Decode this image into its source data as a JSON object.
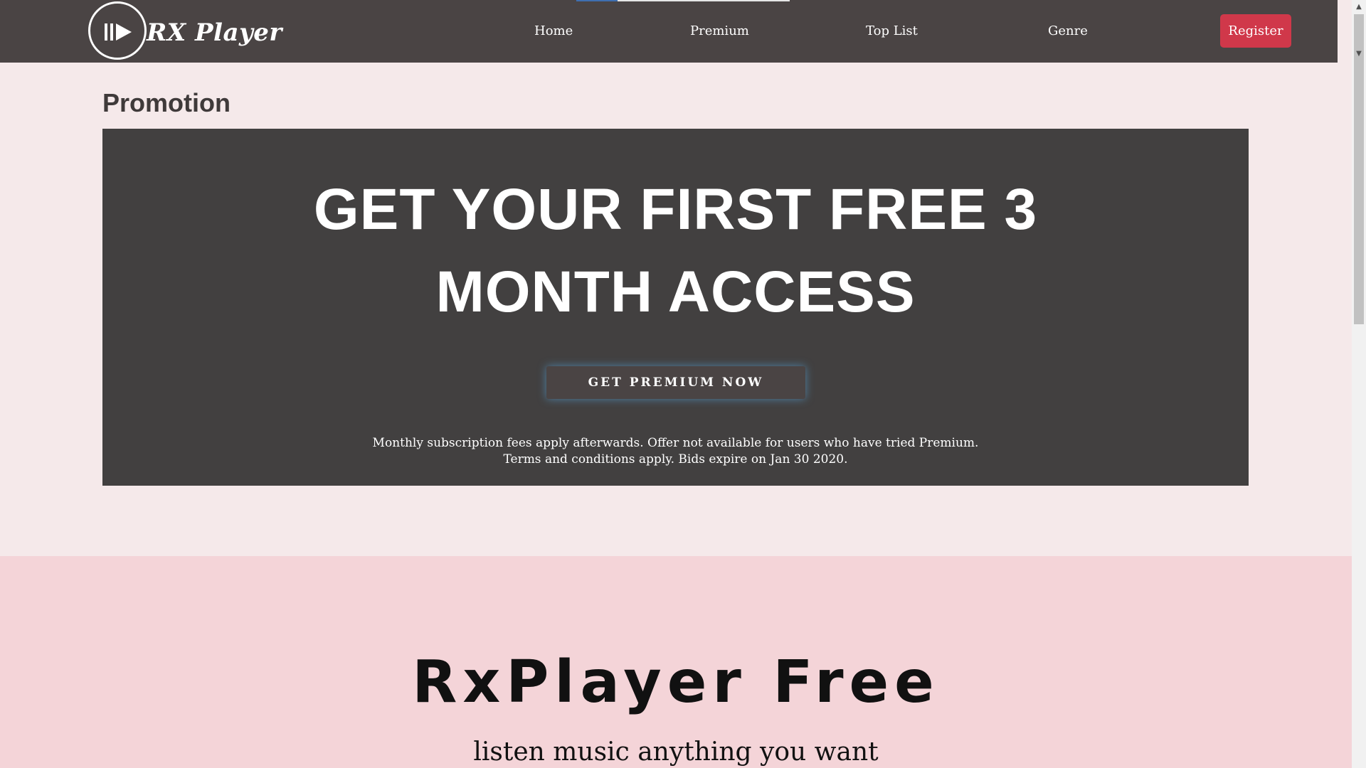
{
  "nav": {
    "logo_text": "RX Player",
    "links": [
      "Home",
      "Premium",
      "Top List",
      "Genre"
    ],
    "register_label": "Register"
  },
  "promotion": {
    "title": "Promotion",
    "headline_line1": "GET YOUR FIRST FREE 3",
    "headline_line2": "MONTH ACCESS",
    "cta_label": "GET PREMIUM NOW",
    "fine_line1": "Monthly subscription fees apply afterwards. Offer not available for users who have tried Premium.",
    "fine_line2": "Terms and conditions apply. Bids expire on Jan 30 2020."
  },
  "free": {
    "title": "RxPlayer Free",
    "subtitle": "listen music anything you want"
  },
  "icons": {
    "logo": "pause-play-icon",
    "scroll_up": "chevron-up-icon",
    "scroll_down": "chevron-down-icon"
  },
  "colors": {
    "navbar": "#4a4444",
    "register": "#d0384a",
    "promo_box": "#424040",
    "page_bg": "#f5e9ea",
    "free_bg": "#f4d4d8"
  }
}
